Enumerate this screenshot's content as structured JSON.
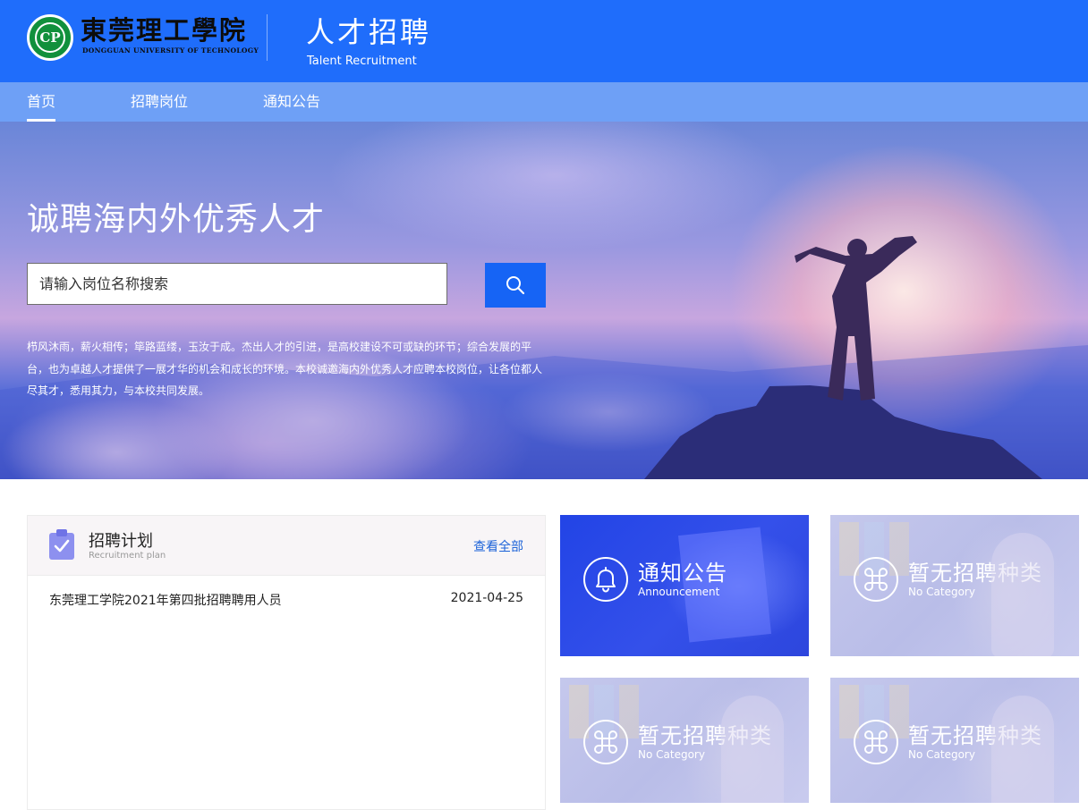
{
  "header": {
    "logo_cn": "東莞理工學院",
    "logo_en": "DONGGUAN UNIVERSITY OF TECHNOLOGY",
    "title": "人才招聘",
    "subtitle": "Talent Recruitment"
  },
  "nav": {
    "items": [
      {
        "label": "首页",
        "active": true
      },
      {
        "label": "招聘岗位",
        "active": false
      },
      {
        "label": "通知公告",
        "active": false
      }
    ]
  },
  "banner": {
    "headline": "诚聘海内外优秀人才",
    "search_placeholder": "请输入岗位名称搜索",
    "description": "栉风沐雨，薪火相传；筚路蓝缕，玉汝于成。杰出人才的引进，是高校建设不可或缺的环节；综合发展的平台，也为卓越人才提供了一展才华的机会和成长的环境。本校诚邀海内外优秀人才应聘本校岗位，让各位都人尽其才，悉用其力，与本校共同发展。"
  },
  "plan": {
    "title": "招聘计划",
    "subtitle": "Recruitment plan",
    "more_label": "查看全部",
    "rows": [
      {
        "title": "东莞理工学院2021年第四批招聘聘用人员",
        "date": "2021-04-25"
      }
    ]
  },
  "cards": [
    {
      "title": "通知公告",
      "subtitle": "Announcement",
      "icon": "bell-icon"
    },
    {
      "title": "暂无招聘种类",
      "subtitle": "No Category",
      "icon": "command-icon"
    },
    {
      "title": "暂无招聘种类",
      "subtitle": "No Category",
      "icon": "command-icon"
    },
    {
      "title": "暂无招聘种类",
      "subtitle": "No Category",
      "icon": "command-icon"
    }
  ],
  "colors": {
    "header_bg": "#1f6dfb",
    "nav_bg": "#6ea0f6",
    "search_button": "#1664f5",
    "link": "#1d63d8",
    "announcement_card": "#2a48e6",
    "category_card": "#c1c5ea"
  }
}
